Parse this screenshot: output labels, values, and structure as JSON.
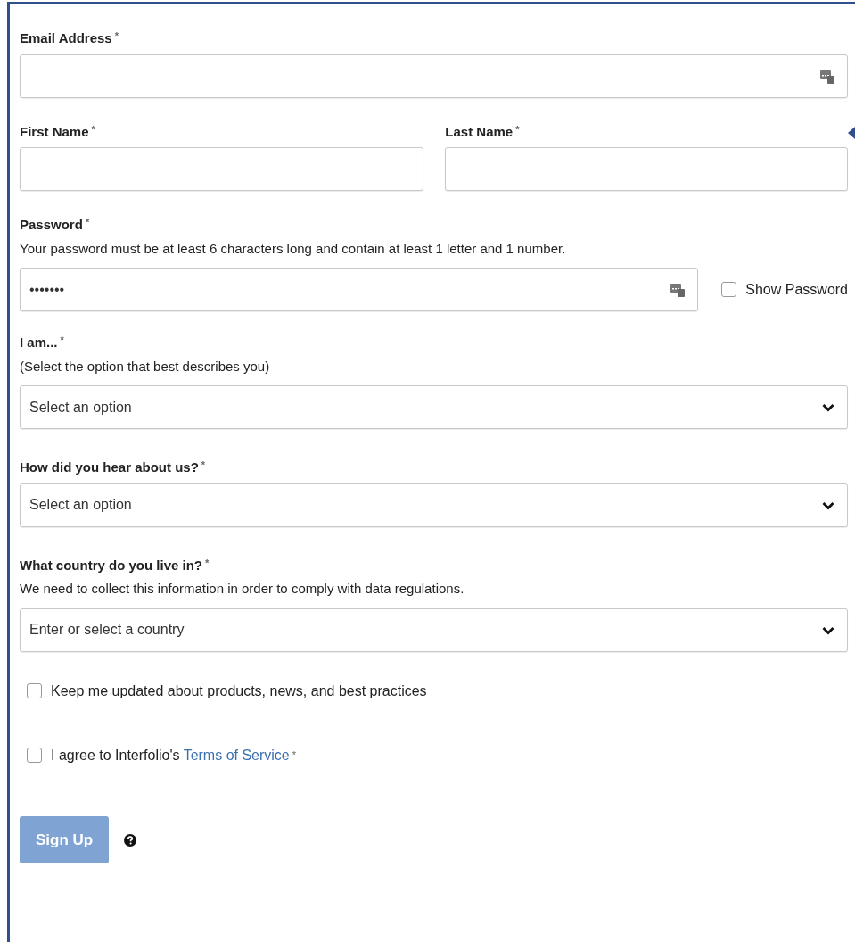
{
  "fields": [
    {
      "kind": "text",
      "label": "Email Address",
      "mark": "*",
      "key_icon": true
    },
    {
      "kind": "pair",
      "items": [
        {
          "label": "First Name",
          "mark": "*"
        },
        {
          "label": "Last Name",
          "mark": "*"
        }
      ]
    },
    {
      "kind": "password",
      "label": "Password",
      "mark": "*",
      "help": "Your password must be at least 6 characters long and contain at least 1 letter and 1 number.",
      "value": "•••••••",
      "key_icon": true,
      "toggle": {
        "label": "Show Password",
        "checked": false
      }
    },
    {
      "kind": "select",
      "label": "I am...",
      "mark": "*",
      "help": "(Select the option that best describes you)",
      "placeholder": "Select an option"
    },
    {
      "kind": "select",
      "label": "How did you hear about us?",
      "mark": "*",
      "placeholder": "Select an option"
    },
    {
      "kind": "select",
      "label": "What country do you live in?",
      "mark": "*",
      "help": "We need to collect this information in order to comply with data regulations.",
      "placeholder": "Enter or select a country"
    },
    {
      "kind": "checkbox",
      "label": "Keep me updated about products, news, and best practices",
      "checked": false
    },
    {
      "kind": "checkbox",
      "label": "I agree to Interfolio's ",
      "link": "Terms of Service",
      "mark": "*",
      "checked": false
    }
  ],
  "submit": {
    "label": "Sign Up",
    "disabled": true
  }
}
